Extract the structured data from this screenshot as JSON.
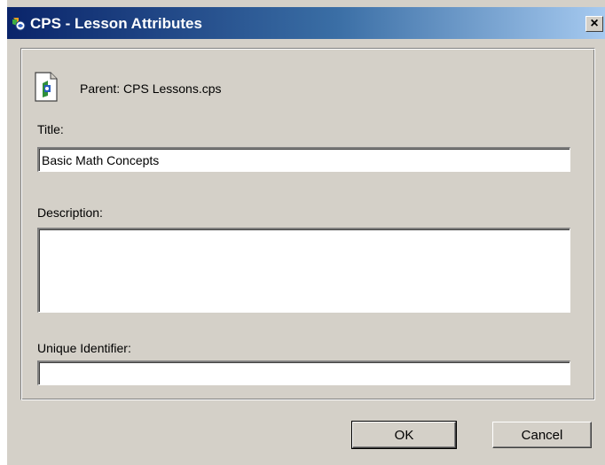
{
  "window": {
    "title": "CPS - Lesson Attributes",
    "close_glyph": "×",
    "app_icon": "cps-app-icon",
    "title_color_start": "#0a246a",
    "title_color_end": "#a6caf0"
  },
  "parent": {
    "icon": "document-icon",
    "text": "Parent: CPS Lessons.cps"
  },
  "title_field": {
    "label": "Title:",
    "value": "Basic Math Concepts"
  },
  "description_field": {
    "label": "Description:",
    "value": ""
  },
  "identifier_field": {
    "label": "Unique Identifier:",
    "value": ""
  },
  "buttons": {
    "ok_label": "OK",
    "cancel_label": "Cancel"
  }
}
